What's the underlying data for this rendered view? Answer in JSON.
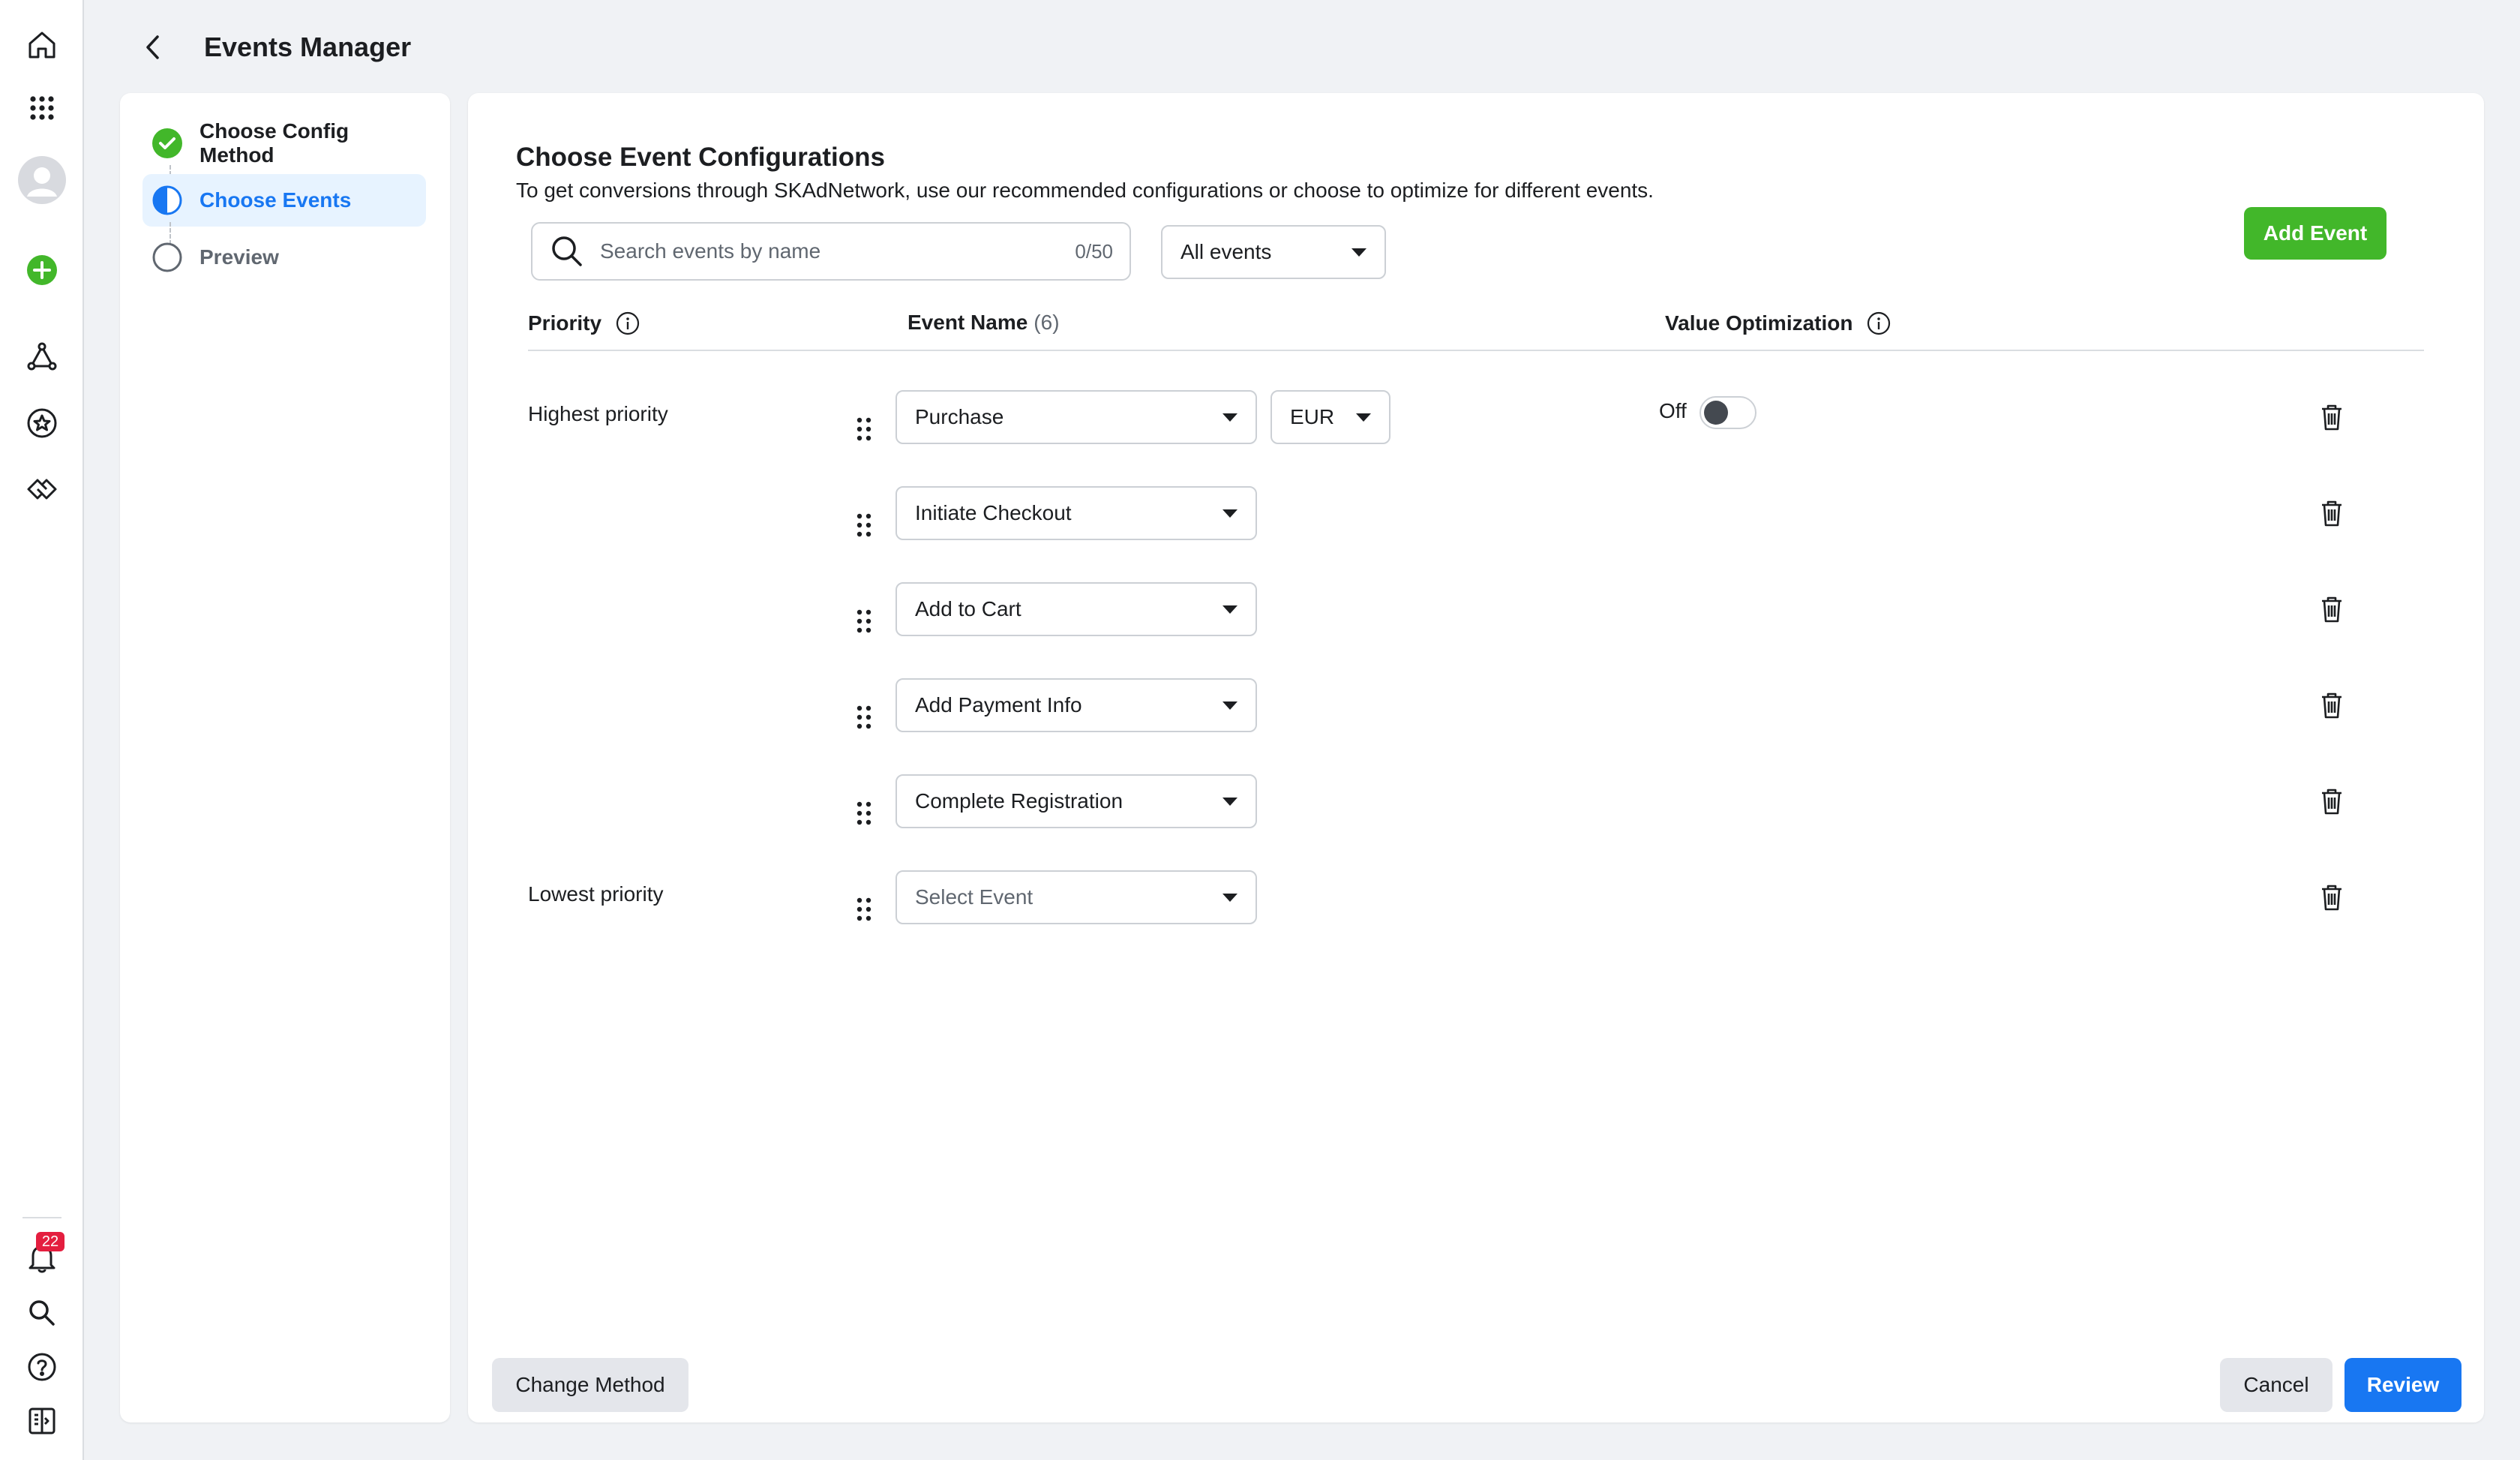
{
  "header": {
    "title": "Events Manager"
  },
  "nav": {
    "notification_count": "22"
  },
  "steps": [
    {
      "label": "Choose Config Method",
      "state": "complete"
    },
    {
      "label": "Choose Events",
      "state": "active"
    },
    {
      "label": "Preview",
      "state": "pending"
    }
  ],
  "main": {
    "title": "Choose Event Configurations",
    "description": "To get conversions through SKAdNetwork, use our recommended configurations or choose to optimize for different events.",
    "search": {
      "placeholder": "Search events by name",
      "value": "",
      "count": "0/50"
    },
    "filter": {
      "value": "All events"
    },
    "add_event_label": "Add Event",
    "columns": {
      "priority": "Priority",
      "event_name": "Event Name",
      "event_count": "(6)",
      "value_optimization": "Value Optimization"
    },
    "priority_labels": {
      "highest": "Highest priority",
      "lowest": "Lowest priority"
    },
    "events": [
      {
        "name": "Purchase",
        "currency": "EUR",
        "value_optimization": "Off"
      },
      {
        "name": "Initiate Checkout"
      },
      {
        "name": "Add to Cart"
      },
      {
        "name": "Add Payment Info"
      },
      {
        "name": "Complete Registration"
      },
      {
        "name": "Select Event",
        "placeholder": true
      }
    ]
  },
  "footer": {
    "change_method_label": "Change Method",
    "cancel_label": "Cancel",
    "review_label": "Review"
  },
  "colors": {
    "accent_blue": "#1877f2",
    "success_green": "#42b72a",
    "badge_red": "#e41e3f",
    "active_step_bg": "#e7f3ff"
  }
}
